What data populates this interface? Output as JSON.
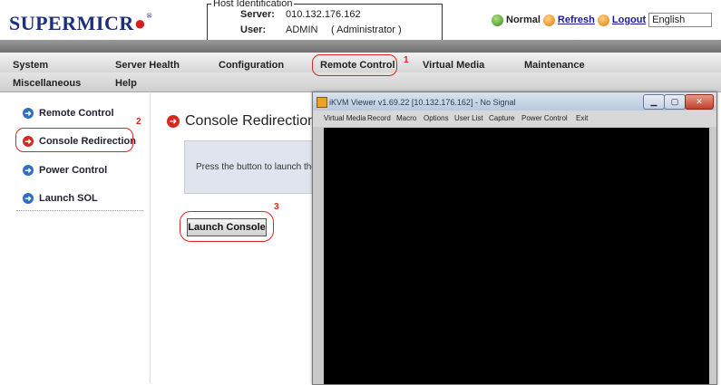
{
  "header": {
    "logo_text": "SUPERMICR",
    "logo_dot": "●",
    "logo_tm": "®",
    "host": {
      "legend": "Host Identification",
      "server_label": "Server:",
      "server_value": "010.132.176.162",
      "user_label": "User:",
      "user_value": "ADMIN",
      "role": "( Administrator )"
    },
    "status_label": "Normal",
    "refresh_label": "Refresh",
    "logout_label": "Logout",
    "language": "English"
  },
  "menu": {
    "system": "System",
    "server_health": "Server Health",
    "configuration": "Configuration",
    "remote_control": "Remote Control",
    "virtual_media": "Virtual Media",
    "maintenance": "Maintenance",
    "miscellaneous": "Miscellaneous",
    "help": "Help"
  },
  "sidebar": {
    "items": [
      {
        "label": "Remote Control"
      },
      {
        "label": "Console Redirection"
      },
      {
        "label": "Power Control"
      },
      {
        "label": "Launch SOL"
      }
    ]
  },
  "content": {
    "title": "Console Redirection",
    "instruction": "Press the button to launch the",
    "launch_button": "Launch Console"
  },
  "annotations": {
    "one": "1",
    "two": "2",
    "three": "3"
  },
  "kvm": {
    "title": "iKVM Viewer v1.69.22 [10.132.176.162] - No Signal",
    "menu": [
      "Virtual Media",
      "Record",
      "Macro",
      "Options",
      "User List",
      "Capture",
      "Power Control",
      "Exit"
    ]
  },
  "colors": {
    "brand": "#1d2f7a",
    "highlight": "#e0241f",
    "screen": "#000000"
  }
}
